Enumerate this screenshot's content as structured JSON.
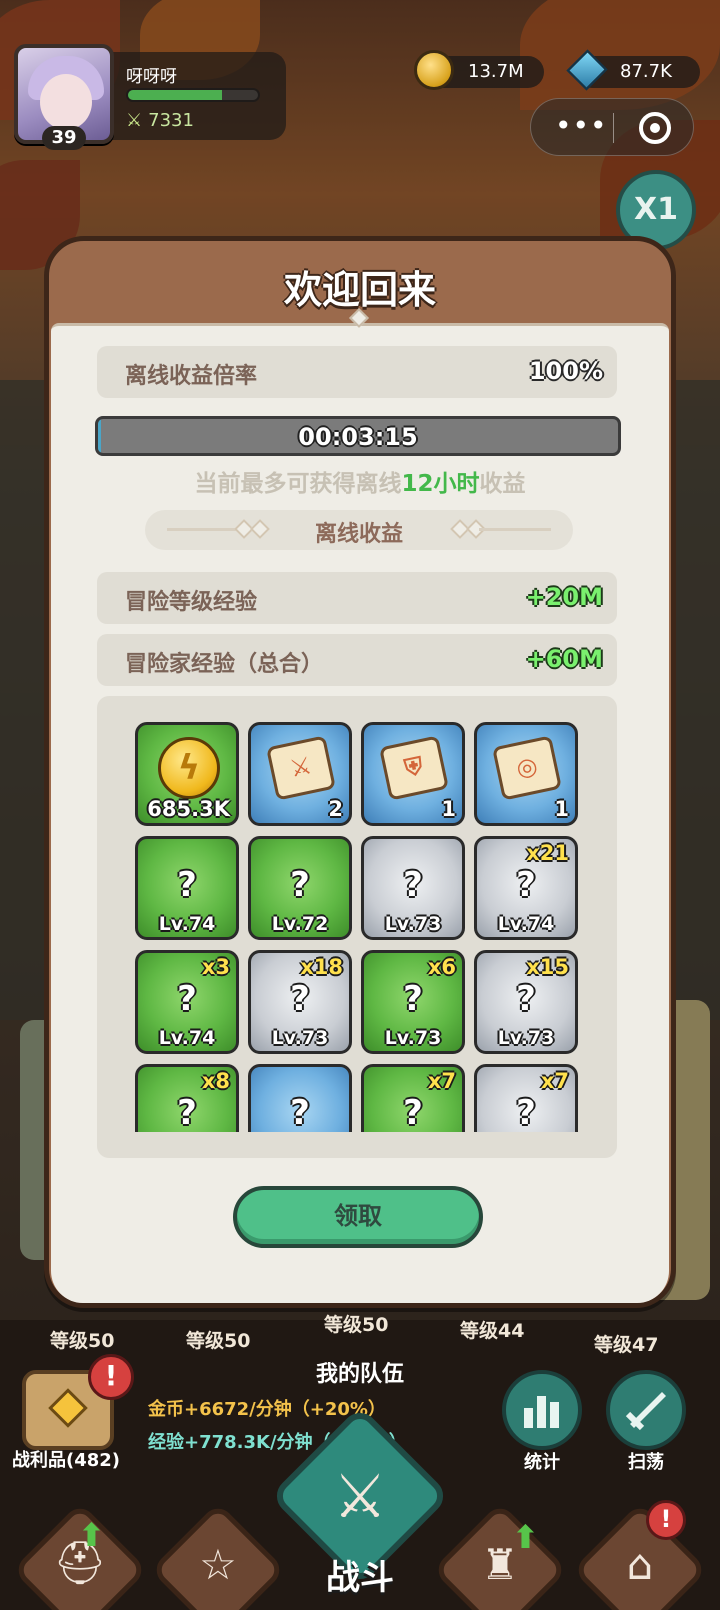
{
  "player": {
    "name": "呀呀呀",
    "level": "39",
    "power": "7331",
    "xp_fraction": 0.72
  },
  "currency": {
    "gold": "13.7M",
    "gems": "87.7K"
  },
  "speed": "X1",
  "modal": {
    "title": "欢迎回来",
    "rate_label": "离线收益倍率",
    "rate_value": "100%",
    "timer": "00:03:15",
    "timer_fraction": 0.005,
    "hint_prefix": "当前最多可获得离线",
    "hint_highlight": "12小时",
    "hint_suffix": "收益",
    "section_label": "离线收益",
    "exp_rows": [
      {
        "label": "冒险等级经验",
        "value": "+20M"
      },
      {
        "label": "冒险家经验（总合）",
        "value": "+60M"
      }
    ],
    "items": [
      {
        "color": "green",
        "kind": "coin",
        "amount": "685.3K"
      },
      {
        "color": "blue",
        "kind": "scroll",
        "emblem": "sword-emblem",
        "amount": "2"
      },
      {
        "color": "blue",
        "kind": "scroll",
        "emblem": "shield-emblem",
        "amount": "1"
      },
      {
        "color": "blue",
        "kind": "scroll",
        "emblem": "ring-emblem",
        "amount": "1"
      },
      {
        "color": "green",
        "kind": "unknown",
        "level": "Lv.74",
        "count": ""
      },
      {
        "color": "green",
        "kind": "unknown",
        "level": "Lv.72",
        "count": ""
      },
      {
        "color": "gray",
        "kind": "unknown",
        "level": "Lv.73",
        "count": ""
      },
      {
        "color": "gray",
        "kind": "unknown",
        "level": "Lv.74",
        "count": "x21"
      },
      {
        "color": "green",
        "kind": "unknown",
        "level": "Lv.74",
        "count": "x3"
      },
      {
        "color": "gray",
        "kind": "unknown",
        "level": "Lv.73",
        "count": "x18"
      },
      {
        "color": "green",
        "kind": "unknown",
        "level": "Lv.73",
        "count": "x6"
      },
      {
        "color": "gray",
        "kind": "unknown",
        "level": "Lv.73",
        "count": "x15"
      },
      {
        "color": "green",
        "kind": "unknown",
        "level": "",
        "count": "x8"
      },
      {
        "color": "blue",
        "kind": "unknown",
        "level": "",
        "count": ""
      },
      {
        "color": "green",
        "kind": "unknown",
        "level": "",
        "count": "x7"
      },
      {
        "color": "gray",
        "kind": "unknown",
        "level": "",
        "count": "x7"
      }
    ],
    "unknown_mark": "?",
    "claim_label": "领取"
  },
  "hud": {
    "team_label": "我的队伍",
    "hero_levels": [
      "等级50",
      "等级50",
      "等级50",
      "等级44",
      "等级47"
    ],
    "loot_label": "战利品(482)",
    "gold_rate": "金币+6672/分钟（+20%）",
    "exp_rate": "经验+778.3K/分钟（+20%）",
    "stats_label": "统计",
    "sweep_label": "扫荡",
    "alert_mark": "!",
    "battle_label": "战斗"
  },
  "colors": {
    "modal_frame": "#9b6a4c",
    "modal_body": "#efede6",
    "highlight_green": "#43b84a",
    "claim_button": "#4fc089",
    "value_green": "#7af06e"
  }
}
